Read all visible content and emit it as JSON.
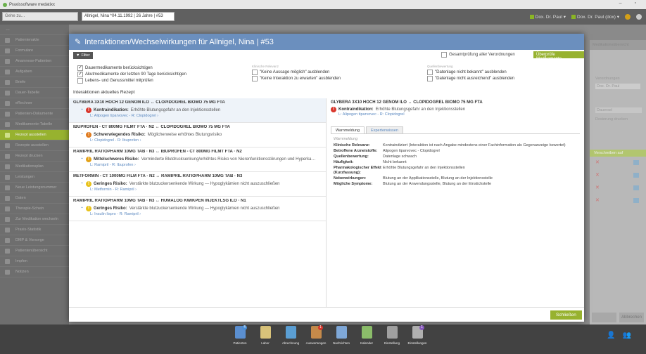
{
  "app": {
    "title": "Praxissoftware medatixx",
    "window_controls": "–  ▫"
  },
  "topbar": {
    "search_placeholder": "Gehe zu…",
    "patient": "Allnigel, Nina *04.11.1992 | 26 Jahre | #53",
    "doc1": "Dox. Dr. Paul",
    "doc2": "Dox. Dr. Paul (dox)"
  },
  "sidebar": {
    "head": "…",
    "items": [
      "Patientenakte",
      "Formulare",
      "Anamnese-Patienten",
      "Aufgaben",
      "Briefe",
      "Dauer-Tabelle",
      "eRechner",
      "Patienten-Dokumente",
      "Medikamente-Tabelle",
      "Rezept ausstellen",
      "Rezepte ausstellen",
      "Rezept drucken",
      "Medikationsplan",
      "Leistungen",
      "Neue Leistungsnummer",
      "Daten",
      "Therapie-Schein",
      "Zur Medikation wechseln",
      "Praxis-Statistik",
      "DMP & Vorsorge",
      "Patientenübersicht",
      "Impfen",
      "Notizen"
    ],
    "highlight_index": 9
  },
  "rightpanel": {
    "head": "Medikationsübersicht",
    "line1": "…",
    "line2": "Verordnungen",
    "line3": "Dox. Dr. Paul",
    "line4": "Dauersel",
    "line5": "Dosierung drucken",
    "green": "Verschreiben auf",
    "btn_cancel": "Abbrechen"
  },
  "modal": {
    "title": "Interaktionen/Wechselwirkungen für Allnigel, Nina | #53",
    "filter_label": "Filter",
    "gesamt_label": "Gesamtprüfung aller Verordnungen",
    "check_button": "Überprüfe Medikamente",
    "filters": {
      "col1": [
        {
          "label": "Dauermedikamente berücksichtigen",
          "checked": true
        },
        {
          "label": "Akutmedikamente der letzten 90 Tage berücksichtigen",
          "checked": true
        },
        {
          "label": "Lebens- und Genussmittel mitprüfen",
          "checked": false
        }
      ],
      "col2_head": "Klinische Relevanz",
      "col2": [
        {
          "label": "\"Keine Aussage möglich\" ausblenden",
          "checked": false
        },
        {
          "label": "\"Keine Interaktion zu erwarten\" ausblenden",
          "checked": false
        }
      ],
      "col3_head": "Quellenbewertung",
      "col3": [
        {
          "label": "\"Datenlage nicht bekannt\" ausblenden",
          "checked": false
        },
        {
          "label": "\"Datenlage nicht ausreichend\" ausblenden",
          "checked": false
        }
      ]
    },
    "section_title": "Interaktionen aktuelles Rezept",
    "interactions": [
      {
        "pair": "GLYBERA 3X10 HOCH 12 GENOM ILO ↔ CLOPIDOGREL BIOMO 75 MG FTA",
        "severity": "Kontraindikation:",
        "text": "Erhöhte Blutungsgefahr an den Injektionsstellen",
        "link": "L: Alipogen tiparvovec - R: Clopidogrel  ›",
        "color": "#d9362b",
        "symbol": "!"
      },
      {
        "pair": "IBUPROFEN - CT 800MG FILMT FTA · N2 ↔ CLOPIDOGREL BIOMO 75 MG FTA",
        "severity": "Schwerwiegendes Risiko:",
        "text": "Möglicherweise erhöhtes Blutungsrisiko",
        "link": "L: Clopidogrel - R: Ibuprofen  ›",
        "color": "#e07b1f",
        "symbol": "!"
      },
      {
        "pair": "RAMIPRIL RATIOPHARM 10MG TAB · N3 ↔ IBUPROFEN - CT 800MG FILMT FTA · N2",
        "severity": "Mittelschweres Risiko:",
        "text": "Verminderte Blutdrucksenkung/erhöhtes Risiko von Nierenfunktionsstörungen und Hyperka…",
        "link": "L: Ramipril - R: Ibuprofen  ›",
        "color": "#e3a21a",
        "symbol": "!"
      },
      {
        "pair": "METFORMIN - CT 1000MG FILM FTA · N2 ↔ RAMIPRIL RATIOPHARM 10MG TAB · N3",
        "severity": "Geringes Risiko:",
        "text": "Verstärkte blutzuckersenkende Wirkung — Hypoglykämien nicht auszuschließen",
        "link": "L: Metformin - R: Ramipril  ›",
        "color": "#e8c21a",
        "symbol": "!"
      },
      {
        "pair": "RAMIPRIL RATIOPHARM 10MG TAB · N3 ↔ HUMALOG KWIKPEN INJEKTLSG ILO · N1",
        "severity": "Geringes Risiko:",
        "text": "Verstärkte blutzuckersenkende Wirkung — Hypoglykämien nicht auszuschließen",
        "link": "L: Insulin lispro - R: Ramipril  ›",
        "color": "#e8c21a",
        "symbol": "!"
      }
    ],
    "detail": {
      "title": "GLYBERA 3X10 HOCH 12 GENOM ILO ↔ CLOPIDOGREL BIOMO 75 MG FTA",
      "severity": "Kontraindikation:",
      "text": "Erhöhte Blutungsgefahr an den Injektionsstellen",
      "link": "L: Alipogen tiparvovec - R: Clopidogrel",
      "tabs": [
        "Warnmeldung",
        "Expertenwissen"
      ],
      "warn_title": "Warnmeldung",
      "rows": [
        {
          "label": "Klinische Relevanz:",
          "value": "Kontraindiziert (Interaktion ist nach Angabe mindestens einer Fachinformation als Gegenanzeige bewertet)"
        },
        {
          "label": "Betroffene Arzneistoffe:",
          "value": "Alipogen tiparvovec - Clopidogrel"
        },
        {
          "label": "Quellenbewertung:",
          "value": "Datenlage schwach"
        },
        {
          "label": "Häufigkeit:",
          "value": "Nicht bekannt"
        },
        {
          "label": "Pharmakologischer Effekt (Kurzfassung):",
          "value": "Erhöhte Blutungsgefahr an den Injektionsstellen"
        },
        {
          "label": "Nebenwirkungen:",
          "value": "Blutung an der Applikationsstelle, Blutung an der Injektionsstelle"
        },
        {
          "label": "Mögliche Symptome:",
          "value": "Blutung an der Anwendungsstelle, Blutung an der Einstichstelle"
        }
      ]
    },
    "close_button": "Schließen"
  },
  "taskbar": [
    {
      "label": "Patienten",
      "color": "#5b8fd0",
      "badge": "4",
      "badge_color": "#4a90d9"
    },
    {
      "label": "Labor",
      "color": "#d9c37a",
      "badge": "",
      "badge_color": ""
    },
    {
      "label": "Abrechnung",
      "color": "#5b9fd4",
      "badge": "",
      "badge_color": ""
    },
    {
      "label": "Auswertungen",
      "color": "#c58a4a",
      "badge": "1",
      "badge_color": "#d9362b"
    },
    {
      "label": "Nachrichten",
      "color": "#7fa8d8",
      "badge": "",
      "badge_color": ""
    },
    {
      "label": "Kalender",
      "color": "#8bbd6a",
      "badge": "",
      "badge_color": ""
    },
    {
      "label": "Einstellung",
      "color": "#a0a0a0",
      "badge": "",
      "badge_color": ""
    },
    {
      "label": "Einstellungen",
      "color": "#b0b0b0",
      "badge": "1",
      "badge_color": "#8a5ac0"
    }
  ]
}
